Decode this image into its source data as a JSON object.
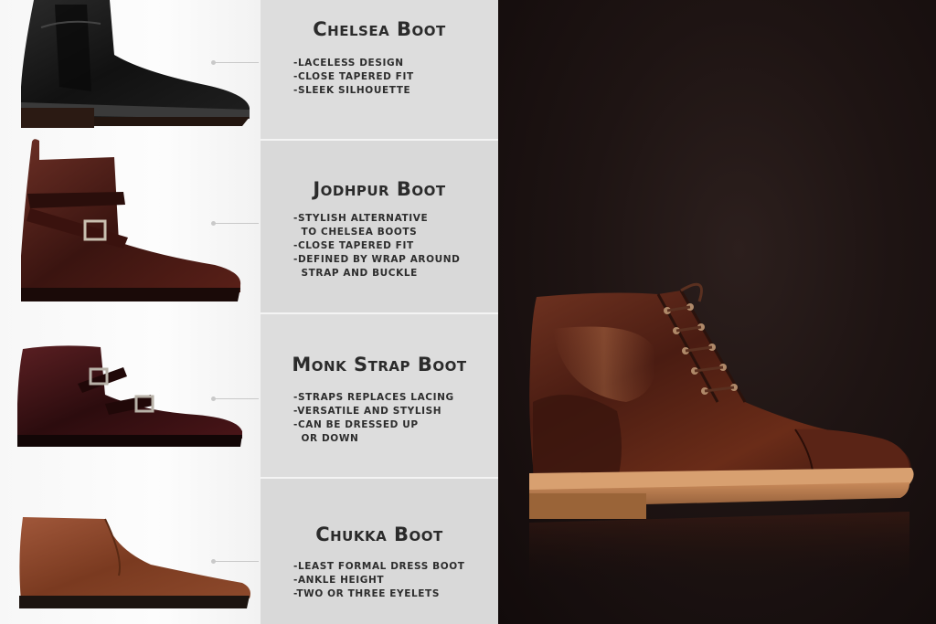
{
  "boots": [
    {
      "title": "Chelsea Boot",
      "features": [
        "-Laceless design",
        "-Close tapered fit",
        "-Sleek silhouette"
      ]
    },
    {
      "title": "Jodhpur Boot",
      "features": [
        "-Stylish alternative",
        "  to Chelsea boots",
        "-Close tapered fit",
        "-Defined by wrap around",
        "  strap and buckle"
      ]
    },
    {
      "title": "Monk Strap Boot",
      "features": [
        "-Straps replaces lacing",
        "-Versatile and stylish",
        "-Can be dressed up",
        "  or down"
      ]
    },
    {
      "title": "Chukka Boot",
      "features": [
        "-Least formal dress boot",
        "-Ankle height",
        "-Two or three eyelets"
      ]
    }
  ],
  "colors": {
    "text_panel": "#dcdcdc",
    "title_text": "#2b2b2b",
    "photo_background": "#1a1110",
    "leather_brown": "#5a2a1c",
    "oxblood": "#4a1a1e",
    "black_leather": "#141414",
    "tan": "#8b4a2c"
  },
  "icons": [
    "chelsea-boot-image",
    "jodhpur-boot-image",
    "monk-strap-boot-image",
    "chukka-boot-image",
    "cap-toe-boot-photo"
  ]
}
